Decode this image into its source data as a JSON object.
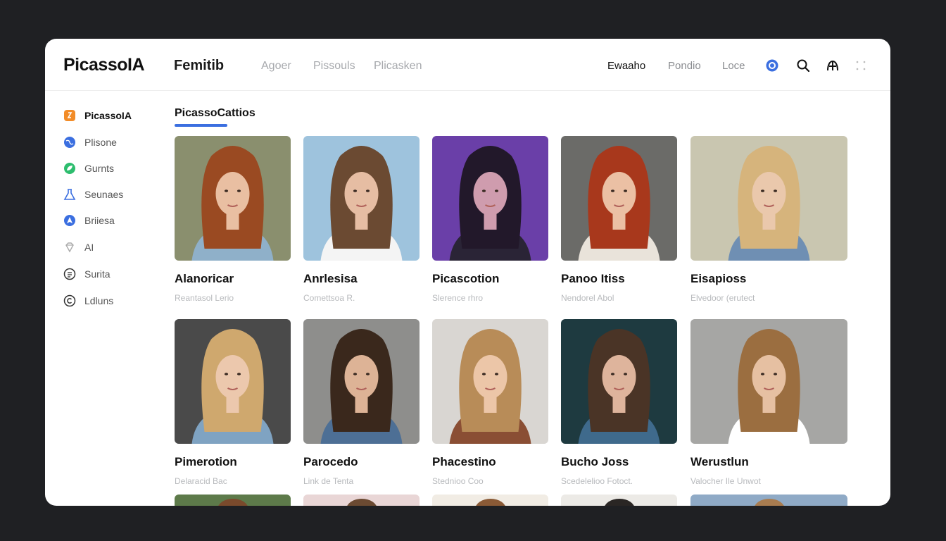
{
  "header": {
    "logo": "PicassoIA",
    "app_title": "Femitib",
    "nav": [
      "Agoer",
      "Pissouls",
      "Plicasken"
    ],
    "right_links": [
      "Ewaaho",
      "Pondio",
      "Loce"
    ],
    "icons": [
      "circle-badge-icon",
      "search-icon",
      "profile-spark-icon",
      "more-icon"
    ]
  },
  "sidebar": {
    "items": [
      {
        "label": "PicassoIA",
        "icon": "brand-square-icon",
        "color": "#f28c28",
        "active": true
      },
      {
        "label": "Plisone",
        "icon": "globe-icon",
        "color": "#3b6fe0"
      },
      {
        "label": "Gurnts",
        "icon": "leaf-icon",
        "color": "#2dbd6e"
      },
      {
        "label": "Seunaes",
        "icon": "flask-icon",
        "color": "#3b6fe0"
      },
      {
        "label": "Briiesa",
        "icon": "navigation-icon",
        "color": "#3b6fe0"
      },
      {
        "label": "AI",
        "icon": "diamond-icon",
        "color": "#999999"
      },
      {
        "label": "Surita",
        "icon": "document-icon",
        "color": "#333333"
      },
      {
        "label": "Ldluns",
        "icon": "copyright-icon",
        "color": "#333333"
      }
    ]
  },
  "main": {
    "section_title": "PicassoCattios",
    "accent": "#3b6fe0",
    "cards": [
      {
        "name": "Alanoricar",
        "sub": "Reantasol Lerio",
        "bg": "#8a8f6e",
        "hair": "#9a4a22",
        "skin": "#e9bfa2",
        "shirt": "#8fb0c9"
      },
      {
        "name": "Anrlesisa",
        "sub": "Comettsoa R.",
        "bg": "#9ec3dd",
        "hair": "#6b4a32",
        "skin": "#e6bda3",
        "shirt": "#f4f4f4"
      },
      {
        "name": "Picascotion",
        "sub": "Slerence rhro",
        "bg": "#6a3fa8",
        "hair": "#22182a",
        "skin": "#cf9cae",
        "shirt": "#2a2436"
      },
      {
        "name": "Panoo Itiss",
        "sub": "Nendorel Abol",
        "bg": "#6b6b68",
        "hair": "#a8381c",
        "skin": "#ebc0a4",
        "shirt": "#e9e3da"
      },
      {
        "name": "Eisapioss",
        "sub": "Elvedoor (erutect",
        "bg": "#c9c6b0",
        "hair": "#d6b47c",
        "skin": "#eac8ac",
        "shirt": "#6f8fb3"
      },
      {
        "name": "Pimerotion",
        "sub": "Delaracid Bac",
        "bg": "#4a4a4a",
        "hair": "#cfa86e",
        "skin": "#ecc8ad",
        "shirt": "#7fa3c2"
      },
      {
        "name": "Parocedo",
        "sub": "Link de Tenta",
        "bg": "#8e8e8c",
        "hair": "#3a281c",
        "skin": "#ddb396",
        "shirt": "#4d6f95"
      },
      {
        "name": "Phacestino",
        "sub": "Stednioo Coo",
        "bg": "#d9d6d2",
        "hair": "#b88c58",
        "skin": "#ecc6a8",
        "shirt": "#8a4e34"
      },
      {
        "name": "Bucho Joss",
        "sub": "Scedelelioo Fotoct.",
        "bg": "#1e3a40",
        "hair": "#4a3426",
        "skin": "#deb49c",
        "shirt": "#3f6a8c"
      },
      {
        "name": "Werustlun",
        "sub": "Valocher Ile Unwot",
        "bg": "#a6a6a4",
        "hair": "#9b6e40",
        "skin": "#e6c0a2",
        "shirt": "#ffffff"
      }
    ],
    "peek_colors": [
      "#5d7a4a",
      "#e9d6d6",
      "#f1ece4",
      "#eceae6",
      "#8faac6"
    ],
    "peek_hair": [
      "#7a4a2c",
      "#6b4a32",
      "#8a5a36",
      "#2a2624",
      "#a87c50"
    ]
  }
}
